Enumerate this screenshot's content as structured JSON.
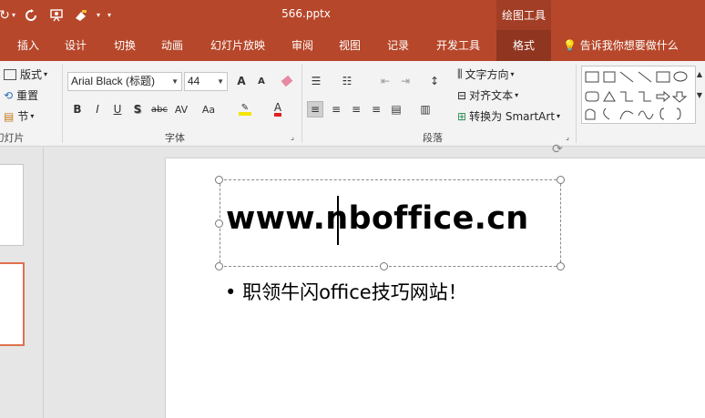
{
  "window": {
    "document_title": "566.pptx",
    "context_tool": "绘图工具"
  },
  "tabs": [
    {
      "label": "插入"
    },
    {
      "label": "设计"
    },
    {
      "label": "切换"
    },
    {
      "label": "动画"
    },
    {
      "label": "幻灯片放映"
    },
    {
      "label": "审阅"
    },
    {
      "label": "视图"
    },
    {
      "label": "记录"
    },
    {
      "label": "开发工具"
    },
    {
      "label": "格式"
    }
  ],
  "tell_me": "告诉我你想要做什么",
  "ribbon": {
    "slides_group": {
      "layout": "版式",
      "reset": "重置",
      "section": "节",
      "label": "幻灯片"
    },
    "font_group": {
      "font_name": "Arial Black (标题)",
      "font_size": "44",
      "label": "字体",
      "bold": "B",
      "italic": "I",
      "underline": "U",
      "shadow": "S",
      "strike": "abc",
      "spacing": "AV",
      "case": "Aa",
      "grow": "A",
      "shrink": "A",
      "font_color": "A"
    },
    "paragraph_group": {
      "text_direction": "文字方向",
      "align_text": "对齐文本",
      "smartart": "转换为 SmartArt",
      "label": "段落"
    }
  },
  "slide": {
    "title": "www.nboffice.cn",
    "bullet": "•",
    "body": "职领牛闪office技巧网站！"
  },
  "colors": {
    "accent": "#b7472a",
    "active_tab": "#8f3520",
    "thumb_selected": "#e0714f"
  }
}
